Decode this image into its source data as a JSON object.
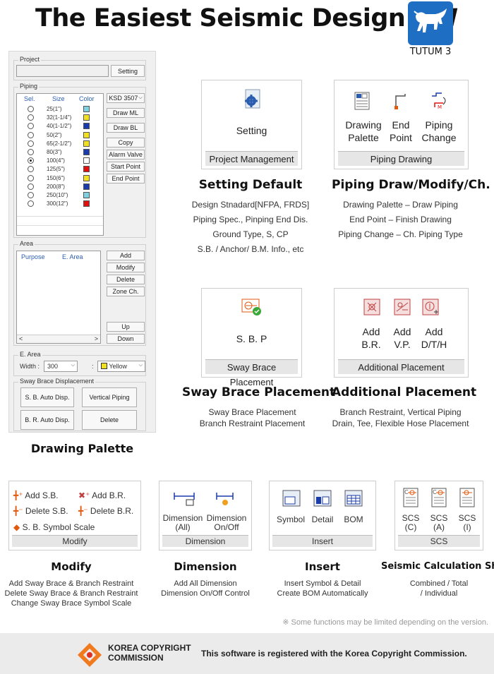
{
  "header": {
    "title": "The Easiest Seismic Design SW",
    "logo_label": "TUTUM 3"
  },
  "palette": {
    "caption": "Drawing Palette",
    "project": {
      "legend": "Project",
      "setting_button": "Setting"
    },
    "piping": {
      "legend": "Piping",
      "headers": [
        "Sel.",
        "Size",
        "Color"
      ],
      "standard_select": "KSD 3507",
      "rows": [
        {
          "size": "25(1\")",
          "color": "#7fd0e0",
          "selected": false
        },
        {
          "size": "32(1-1/4\")",
          "color": "#f0e020",
          "selected": false
        },
        {
          "size": "40(1-1/2\")",
          "color": "#1a3caa",
          "selected": false
        },
        {
          "size": "50(2\")",
          "color": "#f0e020",
          "selected": false
        },
        {
          "size": "65(2-1/2\")",
          "color": "#f0e020",
          "selected": false
        },
        {
          "size": "80(3\")",
          "color": "#1a3caa",
          "selected": false
        },
        {
          "size": "100(4\")",
          "color": "#ffffff",
          "selected": true
        },
        {
          "size": "125(5\")",
          "color": "#e01010",
          "selected": false
        },
        {
          "size": "150(6\")",
          "color": "#f0e020",
          "selected": false
        },
        {
          "size": "200(8\")",
          "color": "#1a3caa",
          "selected": false
        },
        {
          "size": "250(10\")",
          "color": "#7fd0e0",
          "selected": false
        },
        {
          "size": "300(12\")",
          "color": "#e01010",
          "selected": false
        }
      ],
      "buttons": [
        "Draw ML",
        "Draw BL",
        "Copy",
        "Alarm Valve",
        "Start Point",
        "End Point"
      ]
    },
    "area": {
      "legend": "Area",
      "headers": [
        "Purpose",
        "E. Area"
      ],
      "buttons": [
        "Add",
        "Modify",
        "Delete",
        "Zone Ch."
      ],
      "up": "Up",
      "down": "Down",
      "scroll_left": "<",
      "scroll_right": ">"
    },
    "earea": {
      "legend": "E. Area",
      "width_label": "Width :",
      "width_value": "300",
      "colon": ":",
      "color_value": "Yellow"
    },
    "sway": {
      "legend": "Sway Brace Displacement",
      "buttons": [
        "S. B. Auto Disp.",
        "Vertical Piping",
        "B. R. Auto Disp.",
        "Delete"
      ]
    }
  },
  "cards": {
    "setting": {
      "label": "Setting",
      "footer": "Project Management",
      "heading": "Setting Default",
      "desc": [
        "Design Stnadard[NFPA, FRDS]",
        "Piping Spec., Pinping End Dis.",
        "Ground Type, S, CP",
        "S.B. / Anchor/ B.M. Info., etc"
      ]
    },
    "piping": {
      "items": [
        [
          "Drawing",
          "Palette"
        ],
        [
          "End",
          "Point"
        ],
        [
          "Piping",
          "Change"
        ]
      ],
      "footer": "Piping Drawing",
      "heading": "Piping Draw/Modify/Ch.",
      "desc": [
        "Drawing Palette – Draw Piping",
        "End Point – Finish Drawing",
        "Piping Change – Ch. Piping Type"
      ]
    },
    "sbp": {
      "label": "S. B. P",
      "footer": "Sway Brace Placement",
      "heading": "Sway Brace Placement",
      "desc": [
        "Sway Brace Placement",
        "Branch Restraint Placement"
      ]
    },
    "additional": {
      "items": [
        [
          "Add",
          "B.R."
        ],
        [
          "Add",
          "V.P."
        ],
        [
          "Add",
          "D/T/H"
        ]
      ],
      "footer": "Additional Placement",
      "heading": "Additional Placement",
      "desc": [
        "Branch Restraint, Vertical Piping",
        "Drain, Tee, Flexible Hose Placement"
      ]
    }
  },
  "bottom": {
    "modify": {
      "items": [
        "Add S.B.",
        "Add B.R.",
        "Delete S.B.",
        "Delete B.R.",
        "S. B. Symbol Scale"
      ],
      "footer": "Modify",
      "heading": "Modify",
      "desc": [
        "Add Sway Brace & Branch Restraint",
        "Delete Sway Brace & Branch Restraint",
        "Change Sway Brace Symbol Scale"
      ]
    },
    "dimension": {
      "items": [
        [
          "Dimension",
          "(All)"
        ],
        [
          "Dimension",
          "On/Off"
        ]
      ],
      "footer": "Dimension",
      "heading": "Dimension",
      "desc": [
        "Add All Dimension",
        "Dimension On/Off Control"
      ]
    },
    "insert": {
      "items": [
        "Symbol",
        "Detail",
        "BOM"
      ],
      "footer": "Insert",
      "heading": "Insert",
      "desc": [
        "Insert Symbol & Detail",
        "Create BOM Automatically"
      ]
    },
    "scs": {
      "items": [
        [
          "SCS",
          "(C)"
        ],
        [
          "SCS",
          "(A)"
        ],
        [
          "SCS",
          "(I)"
        ]
      ],
      "footer": "SCS",
      "heading": "Seismic Calculation Sheet",
      "desc": [
        "Combined / Total",
        "/ Individual"
      ]
    }
  },
  "note": "※ Some functions may be limited depending on the version.",
  "footer": {
    "org_line1": "KOREA COPYRIGHT",
    "org_line2": "COMMISSION",
    "text": "This software is registered with the Korea Copyright Commission."
  }
}
